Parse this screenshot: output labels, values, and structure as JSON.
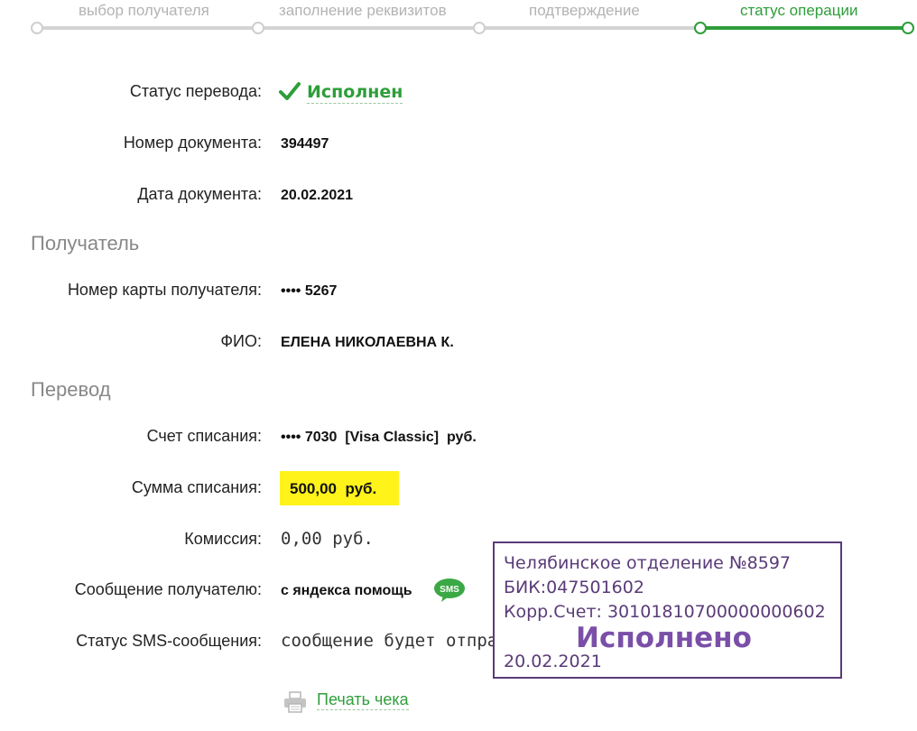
{
  "steps": [
    {
      "label": "выбор получателя",
      "active": false
    },
    {
      "label": "заполнение реквизитов",
      "active": false
    },
    {
      "label": "подтверждение",
      "active": false
    },
    {
      "label": "статус операции",
      "active": true
    }
  ],
  "colors": {
    "accent": "#2e9e3a",
    "highlight": "#fff31a",
    "stamp": "#5a3b78"
  },
  "status": {
    "label": "Статус перевода:",
    "value": "Исполнен",
    "icon": "check-icon"
  },
  "document": {
    "number_label": "Номер документа:",
    "number": "394497",
    "date_label": "Дата документа:",
    "date": "20.02.2021"
  },
  "recipient": {
    "heading": "Получатель",
    "card_label": "Номер карты получателя:",
    "card": "•••• 5267",
    "name_label": "ФИО:",
    "name": "ЕЛЕНА НИКОЛАЕВНА К."
  },
  "transfer": {
    "heading": "Перевод",
    "account_label": "Счет списания:",
    "account": "•••• 7030  [Visa Classic]  руб.",
    "amount_label": "Сумма списания:",
    "amount": "500,00  руб.",
    "fee_label": "Комиссия:",
    "fee": "0,00 руб.",
    "message_label": "Сообщение получателю:",
    "message": "с яндекса помощь",
    "sms_icon_text": "SMS",
    "sms_status_label": "Статус SMS-сообщения:",
    "sms_status": "сообщение будет отправлено"
  },
  "print": {
    "label": "Печать чека",
    "icon": "printer-icon"
  },
  "stamp": {
    "line1": "Челябинское отделение №8597",
    "line2": "БИК:047501602",
    "line3": "Корр.Счет: 30101810700000000602",
    "status": "Исполнено",
    "date": "20.02.2021"
  }
}
